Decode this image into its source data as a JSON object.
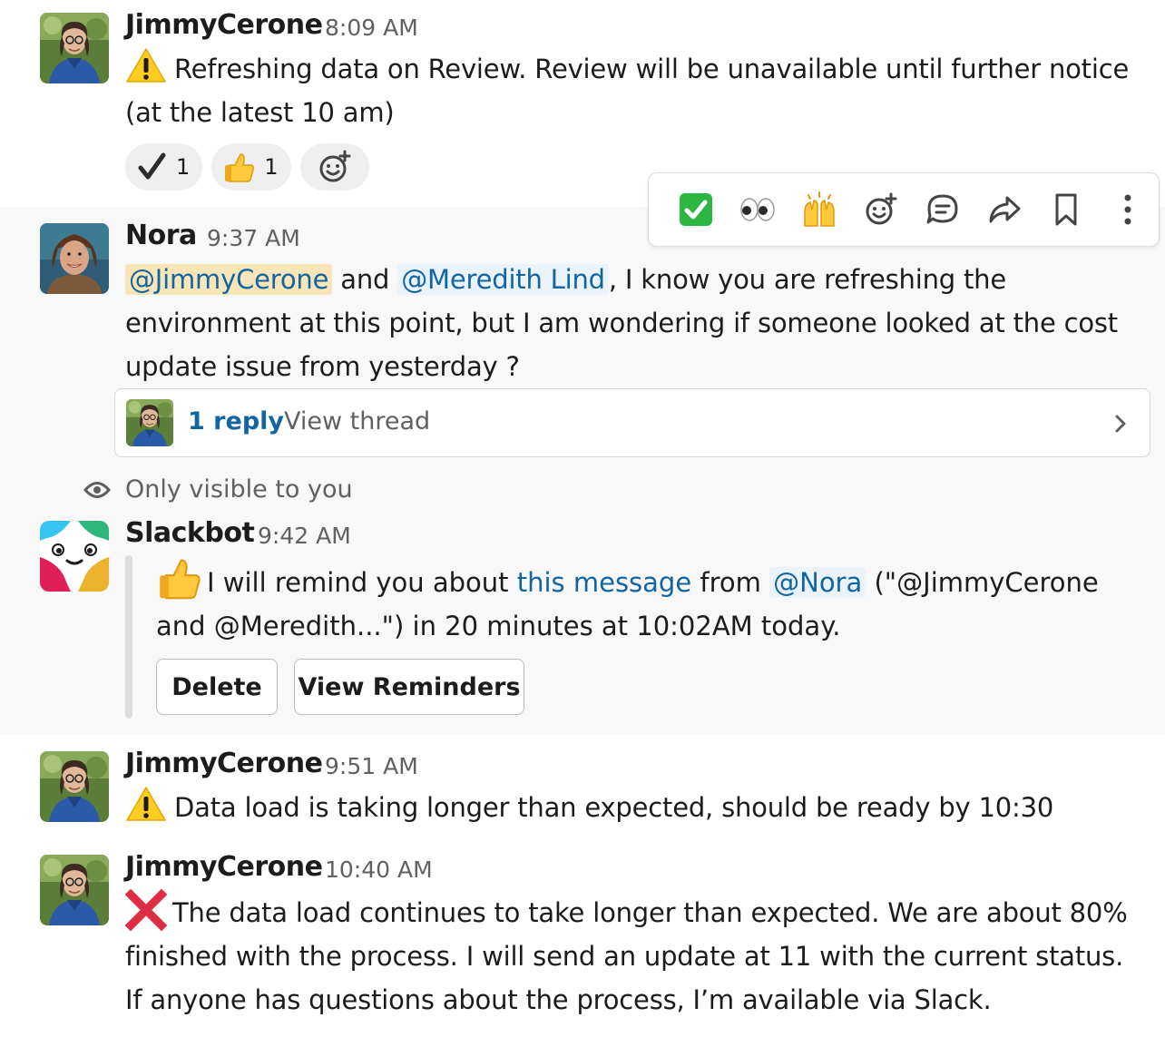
{
  "messages": [
    {
      "author": "JimmyCerone",
      "time": "8:09 AM",
      "text": "Refreshing data on Review. Review will be unavailable until further notice (at the latest 10 am)",
      "emoji": "warning-icon",
      "reactions": [
        {
          "emoji": "check-mark-icon",
          "count": "1"
        },
        {
          "emoji": "thumbs-up-icon",
          "count": "1"
        }
      ]
    },
    {
      "author": "Nora",
      "time": "9:37 AM",
      "mention1": "@JimmyCerone",
      "conj": "and",
      "mention2": "@Meredith Lind",
      "text": ", I know you are refreshing the environment at this point, but I am wondering if someone looked at the cost update issue from yesterday ?",
      "thread": {
        "replies": "1 reply",
        "view": "View thread"
      }
    },
    {
      "notice": "Only visible to you",
      "author": "Slackbot",
      "time": "9:42 AM",
      "part1": "I will remind you about ",
      "link": "this message",
      "part2": " from ",
      "mention": "@Nora",
      "part3": " (\"@JimmyCerone and @Meredith...\") in 20 minutes at 10:02AM today.",
      "buttons": {
        "delete": "Delete",
        "view": "View Reminders"
      }
    },
    {
      "author": "JimmyCerone",
      "time": "9:51 AM",
      "text": "Data load is taking longer than expected, should be ready by 10:30",
      "emoji": "warning-icon"
    },
    {
      "author": "JimmyCerone",
      "time": "10:40 AM",
      "text": "The data load continues to take longer than expected. We are about 80% finished with the process. I will send an update at 11 with the current status. If anyone has questions about the process, I’m available via Slack.",
      "emoji": "cross-mark-icon"
    }
  ],
  "toolbar_icons": [
    "check-mark-button-icon",
    "eyes-icon",
    "raised-hands-icon",
    "add-reaction-icon",
    "reply-in-thread-icon",
    "share-icon",
    "save-bookmark-icon",
    "more-actions-icon"
  ],
  "colors": {
    "link": "#1264a3",
    "mention_bg": "#eaf2fa",
    "self_mention_bg": "#f8e6b8",
    "hover_bg": "#f8f8f8",
    "muted": "#616061"
  }
}
